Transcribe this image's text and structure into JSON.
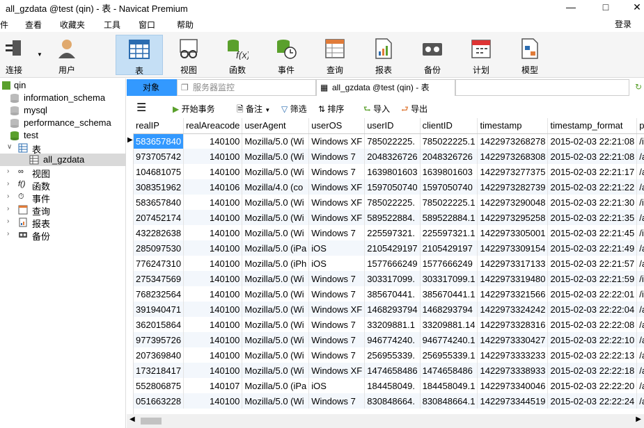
{
  "window": {
    "title": "all_gzdata @test (qin) - 表 - Navicat Premium"
  },
  "menu": [
    "件",
    "查看",
    "收藏夹",
    "工具",
    "窗口",
    "帮助"
  ],
  "login": "登录",
  "toolbar": [
    "连接",
    "用户",
    "表",
    "视图",
    "函数",
    "事件",
    "查询",
    "报表",
    "备份",
    "计划",
    "模型"
  ],
  "tree": {
    "connection": "qin",
    "databases": [
      "information_schema",
      "mysql",
      "performance_schema",
      "test"
    ],
    "group": "表",
    "table": "all_gzdata",
    "others": [
      "视图",
      "函数",
      "事件",
      "查询",
      "报表",
      "备份"
    ]
  },
  "tabs": {
    "objects": "对象",
    "monitor": "服务器监控",
    "active": "all_gzdata @test (qin) - 表"
  },
  "subbar": {
    "begin": "开始事务",
    "memo": "备注",
    "filter": "筛选",
    "sort": "排序",
    "import": "导入",
    "export": "导出"
  },
  "columns": [
    "realIP",
    "realAreacode",
    "userAgent",
    "userOS",
    "userID",
    "clientID",
    "timestamp",
    "timestamp_format",
    "pag"
  ],
  "rows": [
    [
      "583657840",
      "140100",
      "Mozilla/5.0 (Wi",
      "Windows XF",
      "785022225.",
      "785022225.1",
      "1422973268278",
      "2015-02-03 22:21:08",
      "/inf"
    ],
    [
      "973705742",
      "140100",
      "Mozilla/5.0 (Wi",
      "Windows 7",
      "2048326726",
      "2048326726",
      "1422973268308",
      "2015-02-03 22:21:08",
      "/as"
    ],
    [
      "104681075",
      "140100",
      "Mozilla/5.0 (Wi",
      "Windows 7",
      "1639801603",
      "1639801603",
      "1422973277375",
      "2015-02-03 22:21:17",
      "/as"
    ],
    [
      "308351962",
      "140106",
      "Mozilla/4.0 (co",
      "Windows XF",
      "1597050740",
      "1597050740",
      "1422973282739",
      "2015-02-03 22:21:22",
      "/as"
    ],
    [
      "583657840",
      "140100",
      "Mozilla/5.0 (Wi",
      "Windows XF",
      "785022225.",
      "785022225.1",
      "1422973290048",
      "2015-02-03 22:21:30",
      "/inf"
    ],
    [
      "207452174",
      "140100",
      "Mozilla/5.0 (Wi",
      "Windows XF",
      "589522884.",
      "589522884.1",
      "1422973295258",
      "2015-02-03 22:21:35",
      "/as"
    ],
    [
      "432282638",
      "140100",
      "Mozilla/5.0 (Wi",
      "Windows 7",
      "225597321.",
      "225597321.1",
      "1422973305001",
      "2015-02-03 22:21:45",
      "/inf"
    ],
    [
      "285097530",
      "140100",
      "Mozilla/5.0 (iPa",
      "iOS",
      "2105429197",
      "2105429197",
      "1422973309154",
      "2015-02-03 22:21:49",
      "/as"
    ],
    [
      "776247310",
      "140100",
      "Mozilla/5.0 (iPh",
      "iOS",
      "1577666249",
      "1577666249",
      "1422973317133",
      "2015-02-03 22:21:57",
      "/as"
    ],
    [
      "275347569",
      "140100",
      "Mozilla/5.0 (Wi",
      "Windows 7",
      "303317099.",
      "303317099.1",
      "1422973319480",
      "2015-02-03 22:21:59",
      "/inf"
    ],
    [
      "768232564",
      "140100",
      "Mozilla/5.0 (Wi",
      "Windows 7",
      "385670441.",
      "385670441.1",
      "1422973321566",
      "2015-02-03 22:22:01",
      "/inf"
    ],
    [
      "391940471",
      "140100",
      "Mozilla/5.0 (Wi",
      "Windows XF",
      "1468293794",
      "1468293794",
      "1422973324242",
      "2015-02-03 22:22:04",
      "/as"
    ],
    [
      "362015864",
      "140100",
      "Mozilla/5.0 (Wi",
      "Windows 7",
      "33209881.1",
      "33209881.14",
      "1422973328316",
      "2015-02-03 22:22:08",
      "/as"
    ],
    [
      "977395726",
      "140100",
      "Mozilla/5.0 (Wi",
      "Windows 7",
      "946774240.",
      "946774240.1",
      "1422973330427",
      "2015-02-03 22:22:10",
      "/as"
    ],
    [
      "207369840",
      "140100",
      "Mozilla/5.0 (Wi",
      "Windows 7",
      "256955339.",
      "256955339.1",
      "1422973333233",
      "2015-02-03 22:22:13",
      "/as"
    ],
    [
      "173218417",
      "140100",
      "Mozilla/5.0 (Wi",
      "Windows XF",
      "1474658486",
      "1474658486",
      "1422973338933",
      "2015-02-03 22:22:18",
      "/as"
    ],
    [
      "552806875",
      "140107",
      "Mozilla/5.0 (iPa",
      "iOS",
      "184458049.",
      "184458049.1",
      "1422973340046",
      "2015-02-03 22:22:20",
      "/as"
    ],
    [
      "051663228",
      "140100",
      "Mozilla/5.0 (Wi",
      "Windows 7",
      "830848664.",
      "830848664.1",
      "1422973344519",
      "2015-02-03 22:22:24",
      "/as"
    ]
  ],
  "icons": {
    "minimize": "minimize-icon",
    "maximize": "maximize-icon",
    "close": "close-icon"
  },
  "colors": {
    "selected_cell": "#3399ff",
    "toolbar_selected": "#c5dff5",
    "alt_row": "#f3f7fc"
  }
}
